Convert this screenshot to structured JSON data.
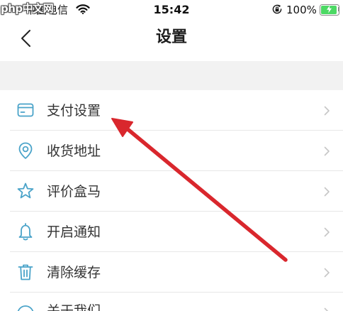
{
  "status_bar": {
    "carrier": "中国电信",
    "time": "15:42",
    "battery_percent": "100%",
    "battery_level": 1.0,
    "icons": [
      "wifi-icon",
      "orientation-lock-icon",
      "battery-charging-icon"
    ]
  },
  "watermark": {
    "text": "php中文网"
  },
  "nav": {
    "back_icon": "chevron-left-icon",
    "title": "设置"
  },
  "settings": {
    "items": [
      {
        "label": "支付设置",
        "icon": "payment-card-icon"
      },
      {
        "label": "收货地址",
        "icon": "location-pin-icon"
      },
      {
        "label": "评价盒马",
        "icon": "star-icon"
      },
      {
        "label": "开启通知",
        "icon": "bell-icon"
      },
      {
        "label": "清除缓存",
        "icon": "trash-icon"
      },
      {
        "label": "关于我们",
        "icon": "info-icon"
      }
    ],
    "row_chevron_icon": "chevron-right-icon"
  },
  "colors": {
    "icon_accent": "#4aa3c9",
    "annotation_arrow": "#d9272d",
    "battery_charging": "#4cd964",
    "divider": "#e7e7e7",
    "section_gap": "#f2f2f2"
  }
}
